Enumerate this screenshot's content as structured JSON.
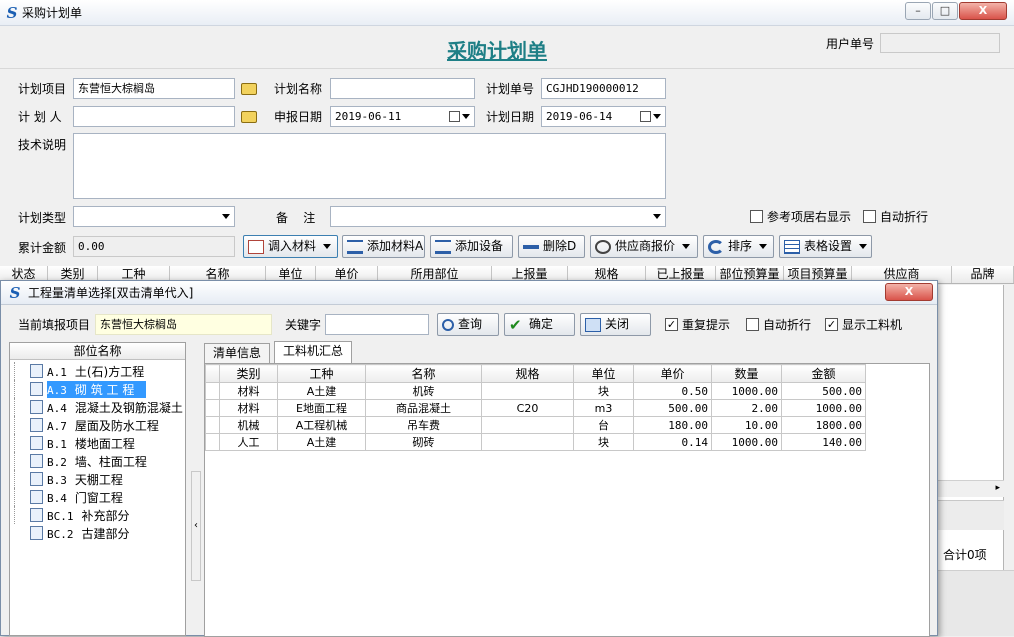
{
  "window": {
    "title": "采购计划单",
    "minimize": "–",
    "maximize": "□",
    "close": "X"
  },
  "form": {
    "heading": "采购计划单",
    "user_no_label": "用户单号",
    "user_no_value": "",
    "plan_project_label": "计划项目",
    "plan_project_value": "东营恒大棕榈岛",
    "plan_name_label": "计划名称",
    "plan_name_value": "",
    "plan_no_label": "计划单号",
    "plan_no_value": "CGJHD190000012",
    "planner_label": "计 划 人",
    "planner_value": "",
    "report_date_label": "申报日期",
    "report_date_value": "2019-06-11",
    "plan_date_label": "计划日期",
    "plan_date_value": "2019-06-14",
    "tech_desc_label": "技术说明",
    "tech_desc_value": "",
    "plan_type_label": "计划类型",
    "plan_type_value": "",
    "remark_label": "备    注",
    "remark_value": "",
    "ref_right_label": "参考项居右显示",
    "auto_wrap_label": "自动折行",
    "total_label": "累计金额",
    "total_value": "0.00"
  },
  "toolbar": {
    "import_material": "调入材料",
    "add_material": "添加材料A",
    "add_equipment": "添加设备",
    "delete": "删除D",
    "supplier_quote": "供应商报价",
    "sort": "排序",
    "table_settings": "表格设置"
  },
  "main_grid": {
    "headers": [
      "状态",
      "类别",
      "工种",
      "名称",
      "单位",
      "单价",
      "所用部位",
      "上报量",
      "规格",
      "已上报量",
      "部位预算量",
      "项目预算量",
      "供应商",
      "品牌"
    ]
  },
  "right_panel": {
    "summary": "合计0项"
  },
  "dialog": {
    "title": "工程量清单选择[双击清单代入]",
    "current_project_label": "当前填报项目",
    "current_project_value": "东营恒大棕榈岛",
    "keyword_label": "关键字",
    "keyword_value": "",
    "query_btn": "查询",
    "confirm_btn": "确定",
    "close_btn": "关闭",
    "repeat_hint_label": "重复提示",
    "repeat_hint_checked": true,
    "auto_wrap_label": "自动折行",
    "auto_wrap_checked": false,
    "show_material_label": "显示工料机",
    "show_material_checked": true,
    "tree_header": "部位名称",
    "tree": [
      {
        "code": "A.1",
        "name": "土(石)方工程"
      },
      {
        "code": "A.3",
        "name": "砌 筑 工 程"
      },
      {
        "code": "A.4",
        "name": "混凝土及钢筋混凝土"
      },
      {
        "code": "A.7",
        "name": "屋面及防水工程"
      },
      {
        "code": "B.1",
        "name": "楼地面工程"
      },
      {
        "code": "B.2",
        "name": "墙、柱面工程"
      },
      {
        "code": "B.3",
        "name": "天棚工程"
      },
      {
        "code": "B.4",
        "name": "门窗工程"
      },
      {
        "code": "BC.1",
        "name": "补充部分"
      },
      {
        "code": "BC.2",
        "name": "古建部分"
      }
    ],
    "tabs": [
      "清单信息",
      "工料机汇总"
    ],
    "table_headers": [
      "类别",
      "工种",
      "名称",
      "规格",
      "单位",
      "单价",
      "数量",
      "金额"
    ],
    "rows": [
      {
        "category": "材料",
        "trade": "A土建",
        "name": "机砖",
        "spec": "",
        "unit": "块",
        "price": "0.50",
        "qty": "1000.00",
        "amount": "500.00"
      },
      {
        "category": "材料",
        "trade": "E地面工程",
        "name": "商品混凝土",
        "spec": "C20",
        "unit": "m3",
        "price": "500.00",
        "qty": "2.00",
        "amount": "1000.00"
      },
      {
        "category": "机械",
        "trade": "A工程机械",
        "name": "吊车费",
        "spec": "",
        "unit": "台",
        "price": "180.00",
        "qty": "10.00",
        "amount": "1800.00"
      },
      {
        "category": "人工",
        "trade": "A土建",
        "name": "砌砖",
        "spec": "",
        "unit": "块",
        "price": "0.14",
        "qty": "1000.00",
        "amount": "140.00"
      }
    ]
  },
  "colors": {
    "heading": "#1e7f86",
    "selection": "#3399ff",
    "accent_blue": "#1b5fb3"
  }
}
